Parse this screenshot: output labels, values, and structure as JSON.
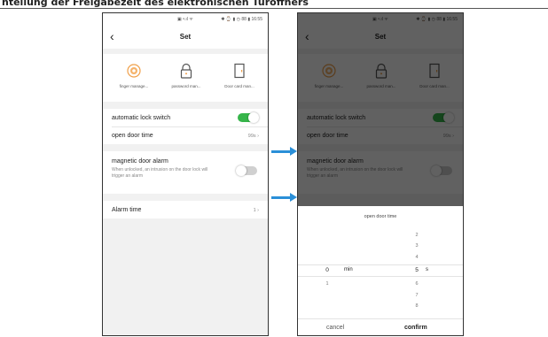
{
  "page_header": "hteilung der Freigabezeit des elektronischen Türöffners",
  "status_bar": {
    "center": "▣ ᵊ.ıl ᯤ",
    "right": "✱ ⌚ ▮ ◷ 88 ▮ 16:55"
  },
  "screen": {
    "back_glyph": "‹",
    "title": "Set",
    "tiles": [
      {
        "label": "finger manage...",
        "icon": "fingerprint-icon"
      },
      {
        "label": "password man...",
        "icon": "lock-icon"
      },
      {
        "label": "Door card man...",
        "icon": "door-card-icon"
      }
    ],
    "auto_lock": {
      "label": "automatic lock switch",
      "on": true
    },
    "open_door_time": {
      "label": "open door time",
      "value": "99s ›"
    },
    "magnetic_alarm": {
      "label": "magnetic door alarm",
      "description": "When unlocked, an intrusion on the door lock will trigger an alarm",
      "on": false
    },
    "alarm_time": {
      "label": "Alarm time",
      "value": "1 ›"
    }
  },
  "picker_sheet": {
    "title": "open door time",
    "minutes_above": "",
    "minutes_selected": "0",
    "minutes_unit": "min",
    "minutes_below": "1",
    "seconds_above": [
      "2",
      "3",
      "4"
    ],
    "seconds_selected": "5",
    "seconds_unit": "s",
    "seconds_below": [
      "6",
      "7",
      "8"
    ],
    "cancel": "cancel",
    "confirm": "confirm"
  },
  "colors": {
    "toggle_on": "#36b54a",
    "toggle_off": "#d0d0d0",
    "arrow": "#2a8fd8",
    "overlay": "rgba(0,0,0,0.62)"
  }
}
